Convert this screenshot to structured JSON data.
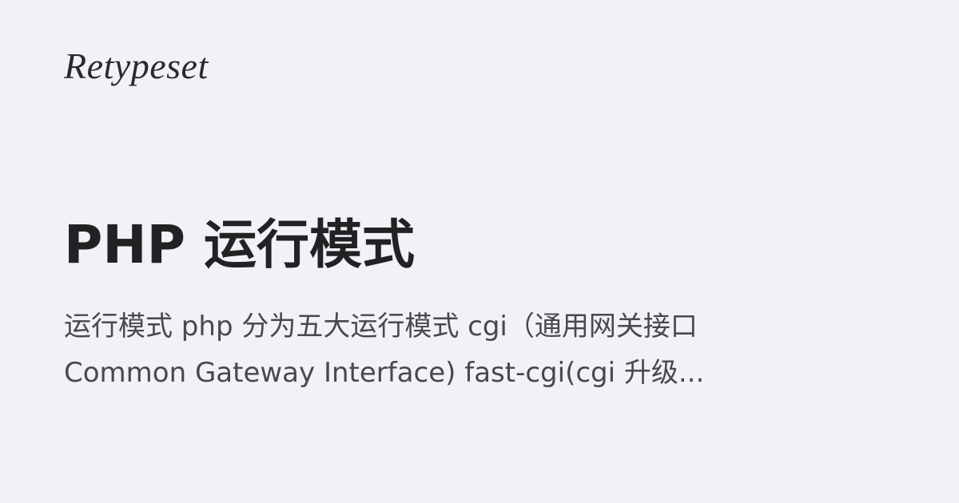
{
  "brand": {
    "logo_text": "Retypeset"
  },
  "post": {
    "title": "PHP 运行模式",
    "description_lines": [
      "运行模式 php 分为五大运行模式 cgi（通用网关接口",
      "Common Gateway Interface) fast-cgi(cgi 升级..."
    ]
  },
  "colors": {
    "background": "#f2f1f6",
    "title": "#222224",
    "description": "#48484d"
  }
}
